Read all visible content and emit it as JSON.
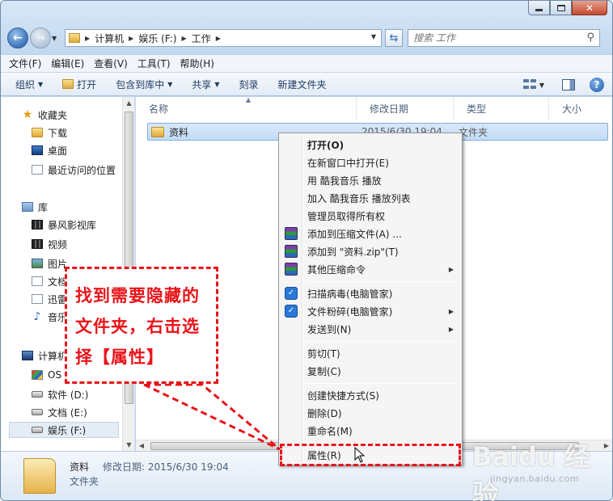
{
  "addressbar": {
    "segments": [
      "计算机",
      "娱乐 (F:)",
      "工作"
    ],
    "search_placeholder": "搜索 工作"
  },
  "menubar": [
    "文件(F)",
    "编辑(E)",
    "查看(V)",
    "工具(T)",
    "帮助(H)"
  ],
  "commandbar": {
    "organize": "组织",
    "open": "打开",
    "include_in_library": "包含到库中",
    "share": "共享",
    "burn": "刻录",
    "new_folder": "新建文件夹"
  },
  "navpane": {
    "favorites": "收藏夹",
    "downloads": "下载",
    "desktop": "桌面",
    "recent": "最近访问的位置",
    "libraries": "库",
    "baofeng": "暴风影视库",
    "videos": "视频",
    "pictures": "图片",
    "documents": "文档",
    "xunlei": "迅雷",
    "music": "音乐",
    "computer": "计算机",
    "os": "OS",
    "drive_d": "软件 (D:)",
    "drive_e": "文档 (E:)",
    "drive_f": "娱乐 (F:)"
  },
  "columns": {
    "name": "名称",
    "date": "修改日期",
    "type": "类型",
    "size": "大小"
  },
  "file": {
    "name": "资料",
    "date": "2015/6/30 19:04",
    "type": "文件夹"
  },
  "context_menu": {
    "open": "打开(O)",
    "open_new_window": "在新窗口中打开(E)",
    "play_kuwo": "用 酷我音乐 播放",
    "add_kuwo_list": "加入 酷我音乐 播放列表",
    "admin_ownership": "管理员取得所有权",
    "add_to_archive": "添加到压缩文件(A) ...",
    "add_to_zip": "添加到 \"资料.zip\"(T)",
    "other_compress": "其他压缩命令",
    "scan_virus": "扫描病毒(电脑管家)",
    "shred": "文件粉碎(电脑管家)",
    "send_to": "发送到(N)",
    "cut": "剪切(T)",
    "copy": "复制(C)",
    "create_shortcut": "创建快捷方式(S)",
    "delete": "删除(D)",
    "rename": "重命名(M)",
    "properties": "属性(R)"
  },
  "details": {
    "name": "资料",
    "meta": "修改日期: 2015/6/30 19:04",
    "type": "文件夹"
  },
  "annotation": {
    "text": "找到需要隐藏的\n文件夹，右击选\n择【属性】"
  },
  "watermark": {
    "logo": "Baidu 经验",
    "url": "jingyan.baidu.com"
  }
}
